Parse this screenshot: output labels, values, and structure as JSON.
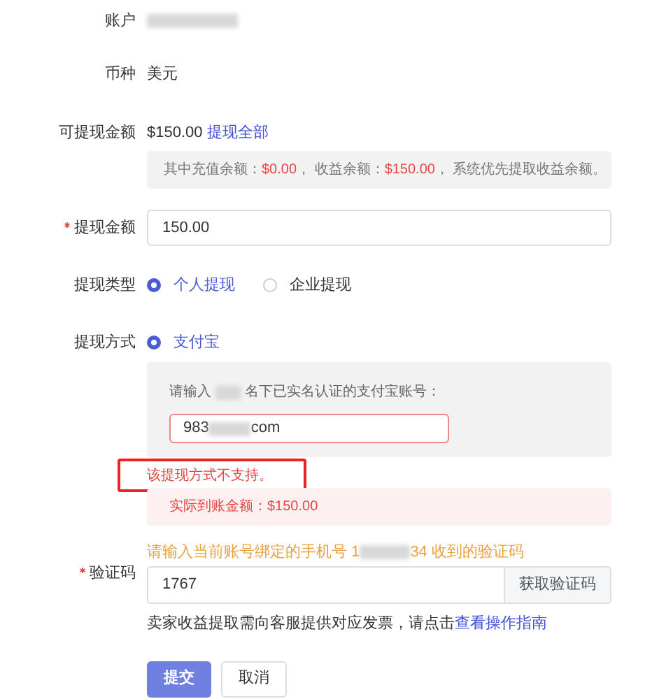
{
  "account": {
    "label": "账户"
  },
  "currency": {
    "label": "币种",
    "value": "美元"
  },
  "available": {
    "label": "可提现金额",
    "amount": "$150.00",
    "link": "提现全部",
    "breakdown": [
      {
        "kind": "text",
        "text": "其中充值余额："
      },
      {
        "kind": "amount",
        "text": "$0.00"
      },
      {
        "kind": "text",
        "text": "， 收益余额："
      },
      {
        "kind": "amount",
        "text": "$150.00"
      },
      {
        "kind": "text",
        "text": "， 系统优先提取收益余额。"
      }
    ]
  },
  "amount": {
    "label": "提现金额",
    "required": true,
    "value": "150.00"
  },
  "type": {
    "label": "提现类型",
    "options": [
      {
        "label": "个人提现",
        "selected": true
      },
      {
        "label": "企业提现",
        "selected": false
      }
    ]
  },
  "method": {
    "label": "提现方式",
    "options": [
      {
        "label": "支付宝",
        "selected": true
      }
    ],
    "prompt_start": "请输入",
    "prompt_end": "名下已实名认证的支付宝账号：",
    "value_start": "983",
    "value_end": "com",
    "error": true
  },
  "error_text": "该提现方式不支持。",
  "actual": "实际到账金额：$150.00",
  "code": {
    "label": "验证码",
    "required": true,
    "hint_start": "请输入当前账号绑定的手机号 1",
    "hint_end": "34 收到的验证码",
    "value": "1767",
    "button": "获取验证码"
  },
  "note": {
    "text": "卖家收益提取需向客服提供对应发票，请点击",
    "link": "查看操作指南"
  },
  "buttons": [
    {
      "kind": "primary",
      "label": "提交"
    },
    {
      "kind": "default",
      "label": "取消"
    }
  ]
}
